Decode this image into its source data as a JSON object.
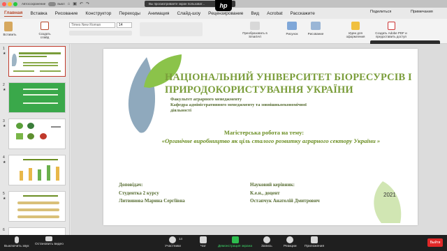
{
  "titlebar": {
    "autosave": "Автосохранение",
    "autosave_state": "выкл",
    "share_notice": "Вы просматриваете экран пользоват...",
    "logo": "hp"
  },
  "tabs": [
    "Главная",
    "Вставка",
    "Рисование",
    "Конструктор",
    "Переходы",
    "Анимация",
    "Слайд-шоу",
    "Рецензирование",
    "Вид",
    "Acrobat",
    "Расскажите"
  ],
  "tabs_right": {
    "share": "Поделиться",
    "comments": "Примечания"
  },
  "ribbon": {
    "paste": "Вставить",
    "new_slide": "Создать слайд",
    "font": "Times New Roman",
    "font_size": "14",
    "smartart": "Преобразовать в SmartArt",
    "picture": "Рисунок",
    "shapes": "Рисование",
    "design_ideas": "Идеи для оформления",
    "adobe": "Создать Adobe PDF и предоставить доступ"
  },
  "tooltip": "Говорит: литвинова",
  "thumbnails": [
    {
      "num": "1",
      "star": "★"
    },
    {
      "num": "2",
      "star": "★"
    },
    {
      "num": "3",
      "star": "★"
    },
    {
      "num": "4",
      "star": "★"
    },
    {
      "num": "5",
      "star": "★"
    },
    {
      "num": "6",
      "star": ""
    }
  ],
  "slide": {
    "title": "НАЦІОНАЛЬНИЙ УНІВЕРСИТЕТ БІОРЕСУРСІВ І ПРИРОДОКОРИСТУВАННЯ УКРАЇНИ",
    "faculty_line1": "Факультет аграрного менеджменту",
    "faculty_line2": "Кафедра адміністративного менеджменту та зовнішньоекономічної діяльності",
    "mag_work": "Магістерська робота на тему:",
    "topic": "«Органічне виробництво як ціль сталого розвитку аграрного сектору України »",
    "author_label": "Доповідач:",
    "author_role": "Студентка 2 курсу",
    "author_name": "Литвинова Марина Сергіївна",
    "advisor_label": "Науковий керівник:",
    "advisor_degree": "К.е.н., доцент",
    "advisor_name": "Остапчук Анатолій Дмитрович",
    "year": "2021"
  },
  "zoom_bar": {
    "mic": "Выключить звук",
    "video": "Остановить видео",
    "participants": "Участники",
    "participants_count": "14",
    "chat": "Чат",
    "share": "Демонстрация экрана",
    "record": "Запись",
    "reactions": "Реакции",
    "apps": "Приложения",
    "end": "Выйти"
  },
  "colors": {
    "accent_red": "#b7472a",
    "slide_green": "#7a9d3a",
    "leaf_blue": "#8fa9bd",
    "leaf_green": "#8bc34a"
  }
}
